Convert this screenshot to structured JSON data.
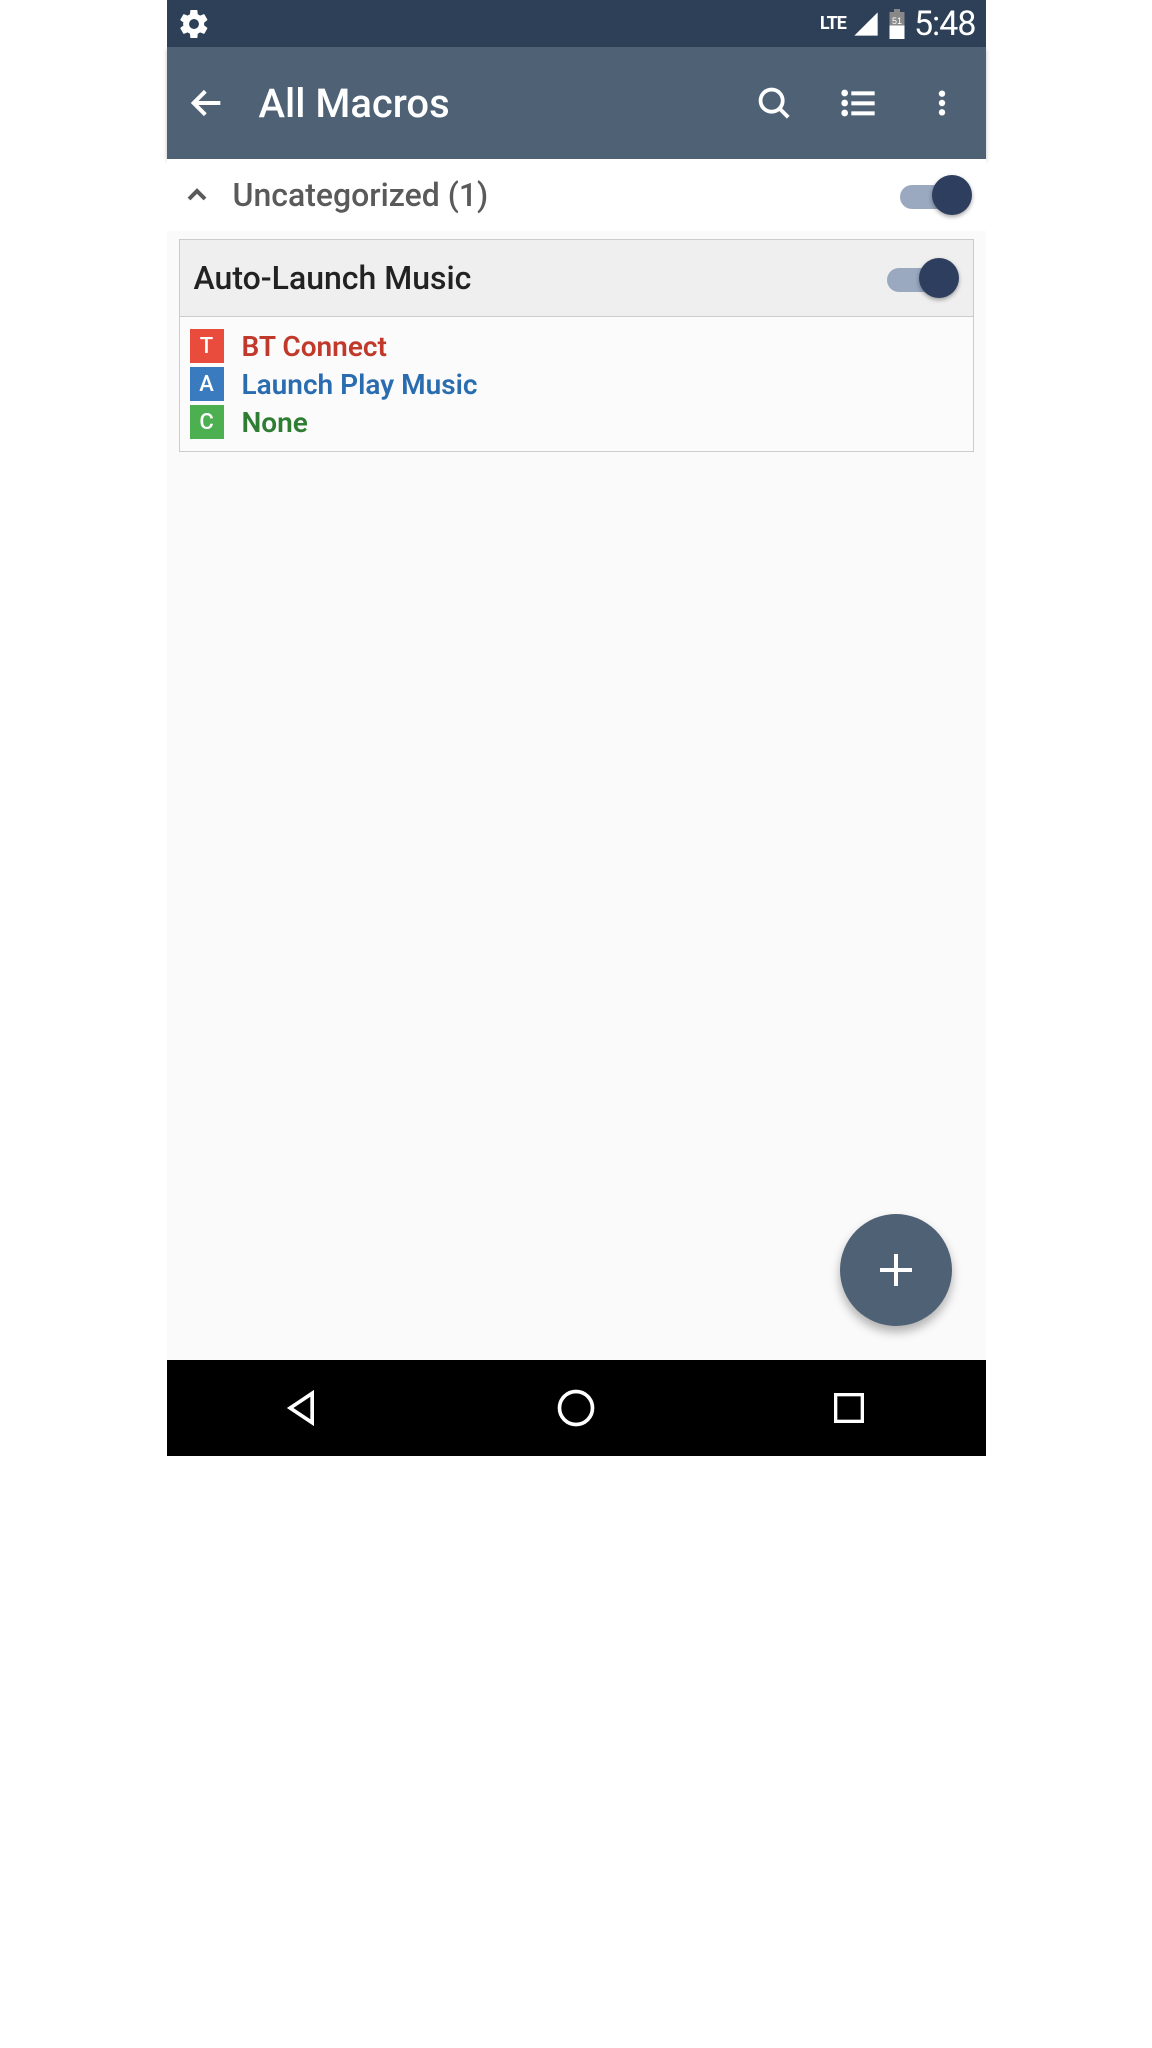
{
  "status": {
    "network": "LTE",
    "battery_level": "51",
    "time": "5:48"
  },
  "appbar": {
    "title": "All Macros"
  },
  "category": {
    "name": "Uncategorized",
    "count": "(1)",
    "full_label": "Uncategorized (1)",
    "toggle_on": true
  },
  "macro": {
    "name": "Auto-Launch Music",
    "toggle_on": true,
    "trigger": {
      "badge": "T",
      "label": "BT Connect",
      "badge_color": "#e94b3c",
      "text_color": "#c1392b"
    },
    "action": {
      "badge": "A",
      "label": "Launch Play Music",
      "badge_color": "#3a7bbf",
      "text_color": "#2a6cb0"
    },
    "constraint": {
      "badge": "C",
      "label": "None",
      "badge_color": "#4caf50",
      "text_color": "#2e7d32"
    }
  },
  "colors": {
    "status_bar": "#2d4057",
    "app_bar": "#4f6275",
    "toggle_thumb": "#2d3e5e",
    "toggle_track": "#9aa8c0"
  }
}
